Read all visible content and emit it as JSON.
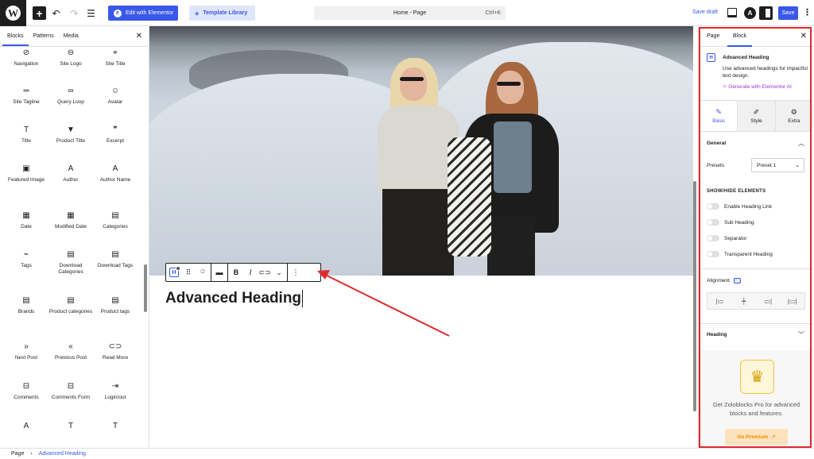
{
  "topbar": {
    "edit_elementor_label": "Edit with Elementor",
    "template_library_label": "Template Library",
    "command_title": "Home - Page",
    "command_shortcut": "Ctrl+K",
    "save_draft_label": "Save draft",
    "save_label": "Save"
  },
  "left_panel": {
    "tabs": [
      "Blocks",
      "Patterns",
      "Media"
    ],
    "active_tab": "Blocks",
    "blocks": [
      {
        "label": "Navigation",
        "icon": "⊘"
      },
      {
        "label": "Site Logo",
        "icon": "⊖"
      },
      {
        "label": "Site Title",
        "icon": "⌖"
      },
      {
        "label": "Site Tagline",
        "icon": "═"
      },
      {
        "label": "Query Loop",
        "icon": "∞"
      },
      {
        "label": "Avatar",
        "icon": "☺"
      },
      {
        "label": "Title",
        "icon": "T"
      },
      {
        "label": "Product Title",
        "icon": "▼"
      },
      {
        "label": "Excerpt",
        "icon": "❞"
      },
      {
        "label": "Featured Image",
        "icon": "▣"
      },
      {
        "label": "Author",
        "icon": "A"
      },
      {
        "label": "Author Name",
        "icon": "A"
      },
      {
        "label": "Date",
        "icon": "▦"
      },
      {
        "label": "Modified Date",
        "icon": "▦"
      },
      {
        "label": "Categories",
        "icon": "▤"
      },
      {
        "label": "Tags",
        "icon": "⌁"
      },
      {
        "label": "Download Categories",
        "icon": "▤"
      },
      {
        "label": "Download Tags",
        "icon": "▤"
      },
      {
        "label": "Brands",
        "icon": "▤"
      },
      {
        "label": "Product categories",
        "icon": "▤"
      },
      {
        "label": "Product tags",
        "icon": "▤"
      },
      {
        "label": "Next Post",
        "icon": "»"
      },
      {
        "label": "Previous Post",
        "icon": "«"
      },
      {
        "label": "Read More",
        "icon": "⊂⊃"
      },
      {
        "label": "Comments",
        "icon": "⊟"
      },
      {
        "label": "Comments Form",
        "icon": "⊟"
      },
      {
        "label": "Login/out",
        "icon": "⇥"
      },
      {
        "label": "",
        "icon": "A"
      },
      {
        "label": "",
        "icon": "T"
      },
      {
        "label": "",
        "icon": "T"
      }
    ]
  },
  "editor": {
    "heading_text": "Advanced Heading"
  },
  "block_toolbar": {
    "bold_label": "B",
    "italic_label": "I"
  },
  "right_panel": {
    "tabs": [
      "Page",
      "Block"
    ],
    "active_tab": "Block",
    "block_name": "Advanced Heading",
    "block_description": "Use advanced headings for impactful text design.",
    "ai_link": "Generate with Elementor AI",
    "sub_tabs": [
      {
        "label": "Basic",
        "icon": "✎"
      },
      {
        "label": "Style",
        "icon": "✐"
      },
      {
        "label": "Extra",
        "icon": "⚙"
      }
    ],
    "general_title": "General",
    "presets_label": "Presets",
    "presets_value": "Preset 1",
    "show_hide_title": "SHOW/HIDE ELEMENTS",
    "toggles": [
      "Enable Heading Link",
      "Sub Heading",
      "Separator",
      "Transparent Heading"
    ],
    "alignment_label": "Alignment",
    "heading_section_title": "Heading",
    "pro_text": "Get Zoloblocks Pro for advanced blocks and features.",
    "go_premium_label": "Go Premium"
  },
  "footer": {
    "crumbs": [
      "Page",
      "Advanced Heading"
    ]
  },
  "colors": {
    "accent": "#3858e9",
    "highlight_outline": "#e0282e",
    "premium": "#f08a00"
  }
}
